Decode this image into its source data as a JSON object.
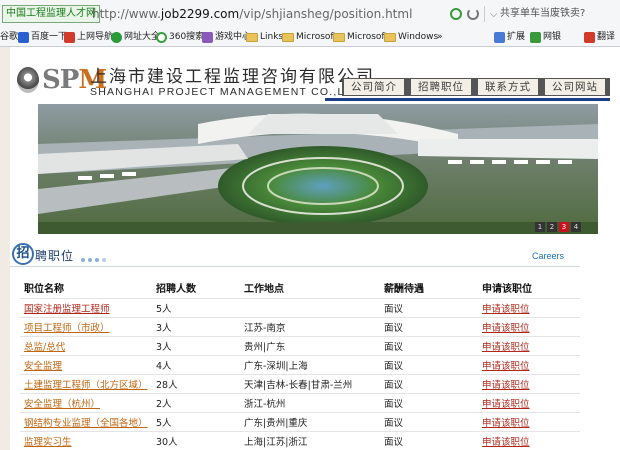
{
  "browser": {
    "tab_title": "中国工程监理人才网",
    "url_prefix": "http://www.",
    "url_domain": "job2299.com",
    "url_path": "/vip/shjiansheg/position.html",
    "search_placeholder": "共享单车当废铁卖?",
    "bookmarks": [
      {
        "label": "谷歌",
        "icon": "partial-icon"
      },
      {
        "label": "百度一下",
        "icon": "baidu-paw-icon"
      },
      {
        "label": "上网导航",
        "icon": "nav-icon"
      },
      {
        "label": "网址大全",
        "icon": "sites-icon"
      },
      {
        "label": "360搜索",
        "icon": "360-icon"
      },
      {
        "label": "游戏中心",
        "icon": "gamepad-icon"
      },
      {
        "label": "Links",
        "icon": "folder-icon"
      },
      {
        "label": "Microsoft",
        "icon": "folder-icon"
      },
      {
        "label": "Microsoft",
        "icon": "folder-icon"
      },
      {
        "label": "Windows",
        "icon": "folder-icon"
      }
    ],
    "overflow": "»",
    "extensions": {
      "label": "扩展"
    },
    "bank": {
      "label": "网银"
    },
    "translate": {
      "label": "翻译"
    }
  },
  "company": {
    "logo_text_a": "SP",
    "logo_text_b": "M",
    "name_cn": "上海市建设工程监理咨询有限公司",
    "name_en": "SHANGHAI PROJECT MANAGEMENT CO.,LTD."
  },
  "nav": [
    "公司简介",
    "招聘职位",
    "联系方式",
    "公司网站"
  ],
  "slider": {
    "pages": [
      "1",
      "2",
      "3",
      "4"
    ],
    "active": "3"
  },
  "section": {
    "badge": "招",
    "title": "聘职位",
    "careers": "Careers"
  },
  "jobs": {
    "headers": [
      "职位名称",
      "招聘人数",
      "工作地点",
      "薪酬待遇",
      "申请该职位"
    ],
    "rows": [
      {
        "title": "国家注册监理工程师",
        "count": "5人",
        "location": "",
        "salary": "面议",
        "apply": "申请该职位"
      },
      {
        "title": "项目工程师（市政）",
        "count": "3人",
        "location": "江苏-南京",
        "salary": "面议",
        "apply": "申请该职位"
      },
      {
        "title": "总监/总代",
        "count": "3人",
        "location": "贵州|广东",
        "salary": "面议",
        "apply": "申请该职位"
      },
      {
        "title": "安全监理",
        "count": "4人",
        "location": "广东-深圳|上海",
        "salary": "面议",
        "apply": "申请该职位"
      },
      {
        "title": "土建监理工程师（北方区域）",
        "count": "28人",
        "location": "天津|吉林-长春|甘肃-兰州",
        "salary": "面议",
        "apply": "申请该职位"
      },
      {
        "title": "安全监理（杭州）",
        "count": "2人",
        "location": "浙江-杭州",
        "salary": "面议",
        "apply": "申请该职位"
      },
      {
        "title": "钢结构专业监理（全国各地）",
        "count": "5人",
        "location": "广东|贵州|重庆",
        "salary": "面议",
        "apply": "申请该职位"
      },
      {
        "title": "监理实习生",
        "count": "30人",
        "location": "上海|江苏|浙江",
        "salary": "面议",
        "apply": "申请该职位"
      }
    ]
  }
}
